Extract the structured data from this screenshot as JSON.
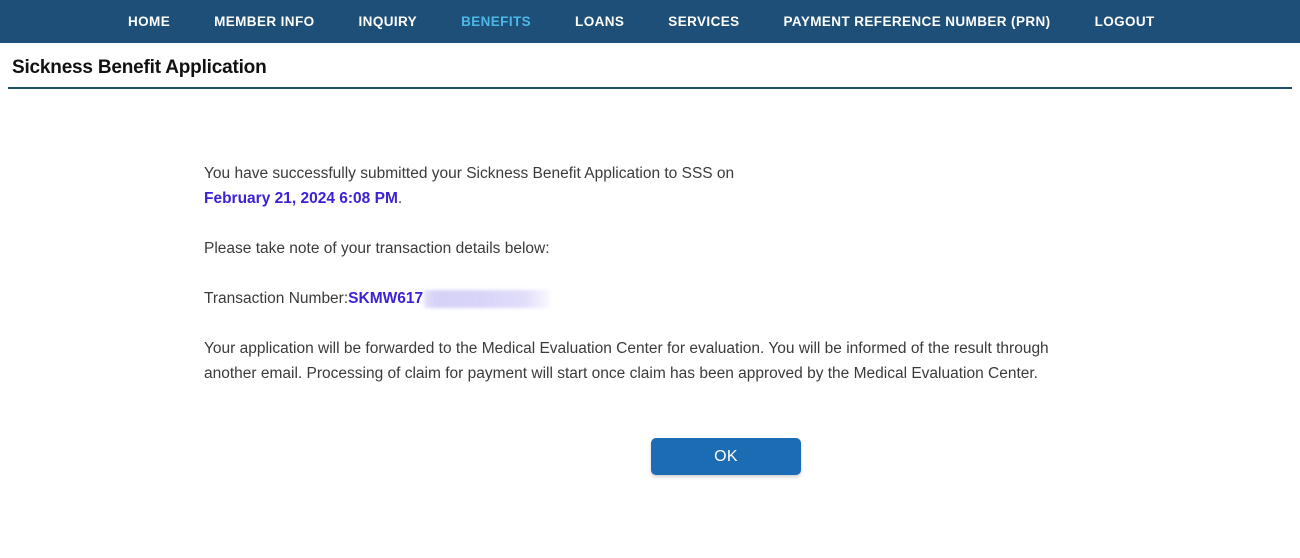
{
  "navbar": {
    "background_color": "#1d4f79",
    "active_color": "#4db8e8",
    "items": [
      {
        "label": "HOME",
        "name": "nav-item-home",
        "active": false
      },
      {
        "label": "MEMBER INFO",
        "name": "nav-item-member-info",
        "active": false
      },
      {
        "label": "INQUIRY",
        "name": "nav-item-inquiry",
        "active": false
      },
      {
        "label": "BENEFITS",
        "name": "nav-item-benefits",
        "active": true
      },
      {
        "label": "LOANS",
        "name": "nav-item-loans",
        "active": false
      },
      {
        "label": "SERVICES",
        "name": "nav-item-services",
        "active": false
      },
      {
        "label": "PAYMENT REFERENCE NUMBER (PRN)",
        "name": "nav-item-prn",
        "active": false
      },
      {
        "label": "LOGOUT",
        "name": "nav-item-logout",
        "active": false
      }
    ]
  },
  "page": {
    "title": "Sickness Benefit Application",
    "rule_color": "#1b4f64"
  },
  "confirmation": {
    "success_line_prefix": "You have successfully submitted your Sickness Benefit Application to SSS on ",
    "submitted_datetime": "February 21, 2024 6:08 PM",
    "success_line_suffix": ".",
    "note_text": "Please take note of your transaction details below:",
    "transaction_label": "Transaction Number: ",
    "transaction_number_visible": "SKMW617",
    "transaction_number_redacted": true,
    "forward_text": "Your application will be forwarded to the Medical Evaluation Center for evaluation. You will be informed of the result through another email. Processing of claim for payment will start once claim has been approved by the Medical Evaluation Center.",
    "highlight_color": "#3b22d4"
  },
  "actions": {
    "ok_label": "OK",
    "ok_color": "#1c6cb3"
  }
}
